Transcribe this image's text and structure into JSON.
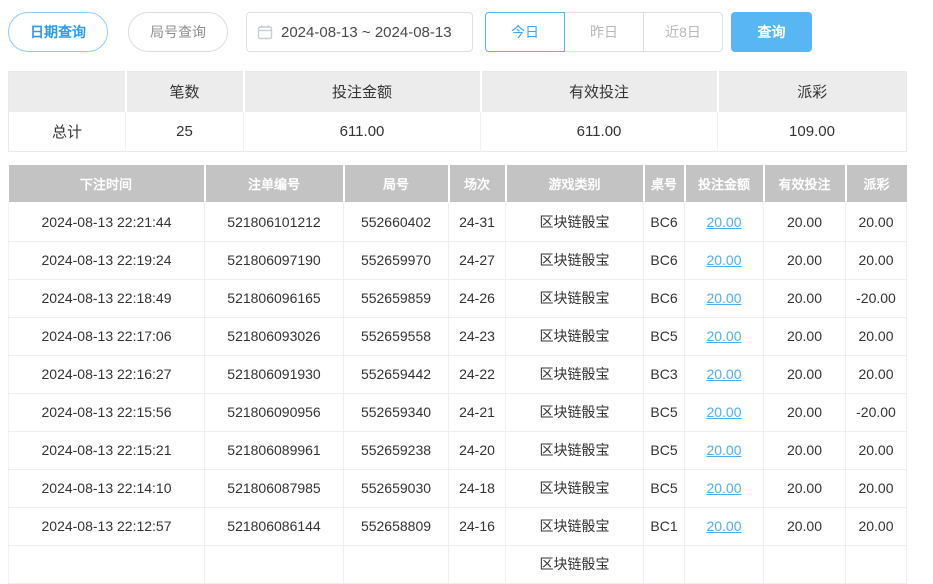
{
  "toolbar": {
    "date_query_label": "日期查询",
    "round_query_label": "局号查询",
    "calendar_icon": "calendar-icon",
    "date_range": "2024-08-13 ~ 2024-08-13",
    "quick_buttons": [
      {
        "label": "今日",
        "active": true
      },
      {
        "label": "昨日",
        "active": false
      },
      {
        "label": "近8日",
        "active": false
      }
    ],
    "search_label": "查询"
  },
  "summary": {
    "headers": [
      "",
      "笔数",
      "投注金额",
      "有效投注",
      "派彩"
    ],
    "row": {
      "label": "总计",
      "count": "25",
      "bet_amount": "611.00",
      "valid_bet": "611.00",
      "payout": "109.00"
    }
  },
  "records": {
    "headers": [
      "下注时间",
      "注单编号",
      "局号",
      "场次",
      "游戏类别",
      "桌号",
      "投注金额",
      "有效投注",
      "派彩"
    ],
    "rows": [
      [
        "2024-08-13 22:21:44",
        "521806101212",
        "552660402",
        "24-31",
        "区块链骰宝",
        "BC6",
        "20.00",
        "20.00",
        "20.00"
      ],
      [
        "2024-08-13 22:19:24",
        "521806097190",
        "552659970",
        "24-27",
        "区块链骰宝",
        "BC6",
        "20.00",
        "20.00",
        "20.00"
      ],
      [
        "2024-08-13 22:18:49",
        "521806096165",
        "552659859",
        "24-26",
        "区块链骰宝",
        "BC6",
        "20.00",
        "20.00",
        "-20.00"
      ],
      [
        "2024-08-13 22:17:06",
        "521806093026",
        "552659558",
        "24-23",
        "区块链骰宝",
        "BC5",
        "20.00",
        "20.00",
        "20.00"
      ],
      [
        "2024-08-13 22:16:27",
        "521806091930",
        "552659442",
        "24-22",
        "区块链骰宝",
        "BC3",
        "20.00",
        "20.00",
        "20.00"
      ],
      [
        "2024-08-13 22:15:56",
        "521806090956",
        "552659340",
        "24-21",
        "区块链骰宝",
        "BC5",
        "20.00",
        "20.00",
        "-20.00"
      ],
      [
        "2024-08-13 22:15:21",
        "521806089961",
        "552659238",
        "24-20",
        "区块链骰宝",
        "BC5",
        "20.00",
        "20.00",
        "20.00"
      ],
      [
        "2024-08-13 22:14:10",
        "521806087985",
        "552659030",
        "24-18",
        "区块链骰宝",
        "BC5",
        "20.00",
        "20.00",
        "20.00"
      ],
      [
        "2024-08-13 22:12:57",
        "521806086144",
        "552658809",
        "24-16",
        "区块链骰宝",
        "BC1",
        "20.00",
        "20.00",
        "20.00"
      ]
    ],
    "partial_row": [
      "",
      "",
      "",
      "",
      "区块链骰宝",
      "",
      "",
      "",
      ""
    ]
  },
  "colors": {
    "accent_blue": "#2d9ceb",
    "search_button_bg": "#58b6f3",
    "link_blue": "#4cb0f0",
    "negative_red": "#f0565f",
    "records_header_bg": "#c3c3c3",
    "summary_header_bg": "#ececec"
  }
}
